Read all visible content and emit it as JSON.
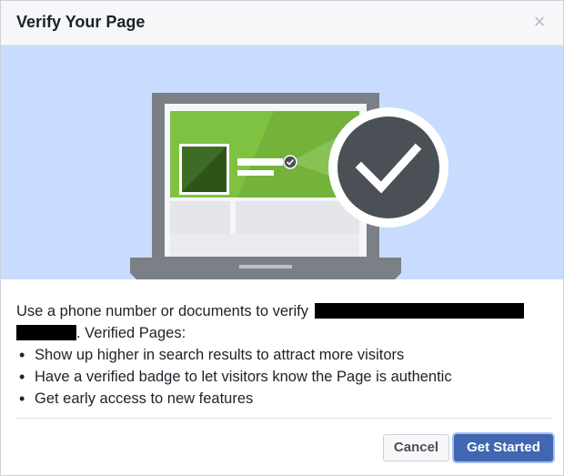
{
  "dialog": {
    "title": "Verify Your Page",
    "close_symbol": "×"
  },
  "hero": {
    "illustration": "laptop-with-verified-checkmark",
    "colors": {
      "background": "#c9dcff",
      "laptop": "#7b7f86",
      "screen_banner": "#7fc242",
      "check_circle": "#4b4f56"
    }
  },
  "body": {
    "intro_prefix": "Use a phone number or documents to verify",
    "intro_suffix": ". Verified Pages:",
    "bullets": [
      "Show up higher in search results to attract more visitors",
      "Have a verified badge to let visitors know the Page is authentic",
      "Get early access to new features"
    ]
  },
  "footer": {
    "cancel_label": "Cancel",
    "primary_label": "Get Started"
  }
}
